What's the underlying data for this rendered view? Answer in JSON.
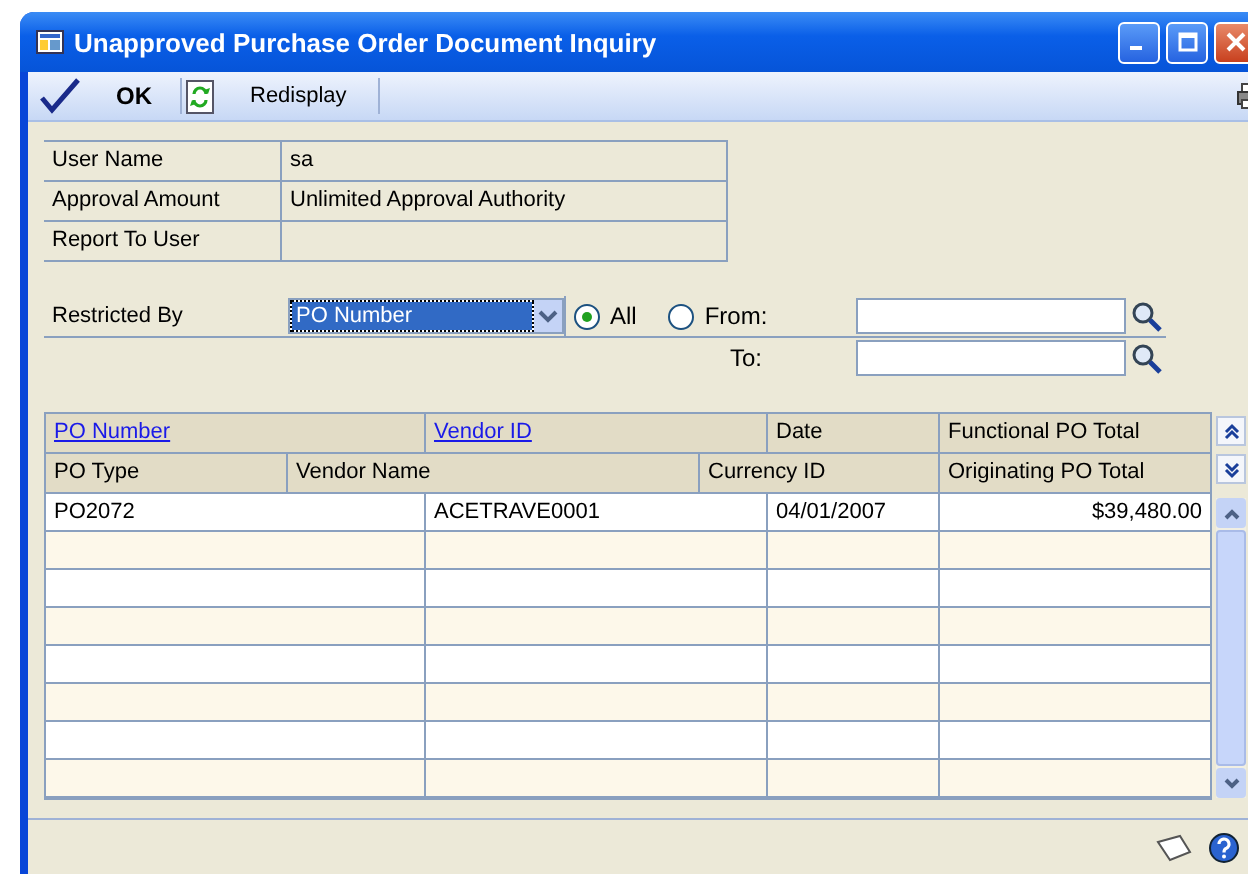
{
  "window": {
    "title": "Unapproved Purchase Order Document Inquiry"
  },
  "toolbar": [
    {
      "label": "OK",
      "kind": "ok"
    },
    {
      "label": "Redisplay",
      "kind": "redisplay"
    }
  ],
  "info": [
    {
      "label": "User Name",
      "value": "sa"
    },
    {
      "label": "Approval Amount",
      "value": "Unlimited Approval Authority"
    },
    {
      "label": "Report To User"
    }
  ],
  "restrict": {
    "label": "Restricted By",
    "value": "PO Number",
    "options": [
      {
        "label": "All",
        "selected": true
      },
      {
        "label": "From:",
        "selected": false
      }
    ],
    "to_label": "To:"
  },
  "grid": {
    "header_1": [
      {
        "label": "PO Number",
        "link": true
      },
      {
        "label": "Vendor ID",
        "link": true
      },
      {
        "label": "Date",
        "link": false
      },
      {
        "label": "Functional PO Total",
        "link": false
      }
    ],
    "header_2": [
      "PO Type",
      "Vendor Name",
      "Currency ID",
      "Originating PO Total"
    ],
    "rows": [
      [
        "PO2072",
        "ACETRAVE0001",
        "04/01/2007",
        "$39,480.00"
      ]
    ]
  }
}
